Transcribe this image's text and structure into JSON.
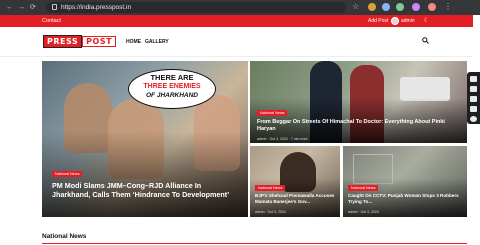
{
  "browser": {
    "url": "https://india.presspost.in",
    "nav_back": "←",
    "nav_forward": "→",
    "nav_reload": "⟳"
  },
  "topbar": {
    "contact": "Contact",
    "add_post": "Add Post",
    "user": "admin",
    "moon_icon": "☾"
  },
  "header": {
    "logo_press": "PRESS",
    "logo_post": "POST",
    "nav": [
      "HOME",
      "GALLERY"
    ]
  },
  "featured": {
    "main": {
      "badge": "National News",
      "title": "PM Modi Slams JMM–Cong–RJD Alliance In Jharkhand, Calls Them ‘Hindrance To Development’",
      "overlay_line1": "THERE ARE",
      "overlay_line2": "THREE ENEMIES",
      "overlay_line3": "OF JHARKHAND"
    },
    "top_right": {
      "badge": "National News",
      "title": "From Beggar On Streets Of Himachal To Doctor: Everything About Pinki Haryan",
      "meta": "admin  ·  Oct 3, 2024  ·  7 min read"
    },
    "bottom_left": {
      "badge": "National News",
      "title": "BJP's Shehzad Poonawalla Accuses Mamata Banerjee's Gov...",
      "meta": "admin  ·  Oct 3, 2024"
    },
    "bottom_right": {
      "badge": "National News",
      "title": "Caught On CCTV: Punjab Woman Stops 3 Robbers Trying To...",
      "meta": "admin  ·  Oct 3, 2024"
    }
  },
  "section_title": "National News",
  "colors": {
    "brand": "#e31e25",
    "chrome": "#35363a"
  }
}
